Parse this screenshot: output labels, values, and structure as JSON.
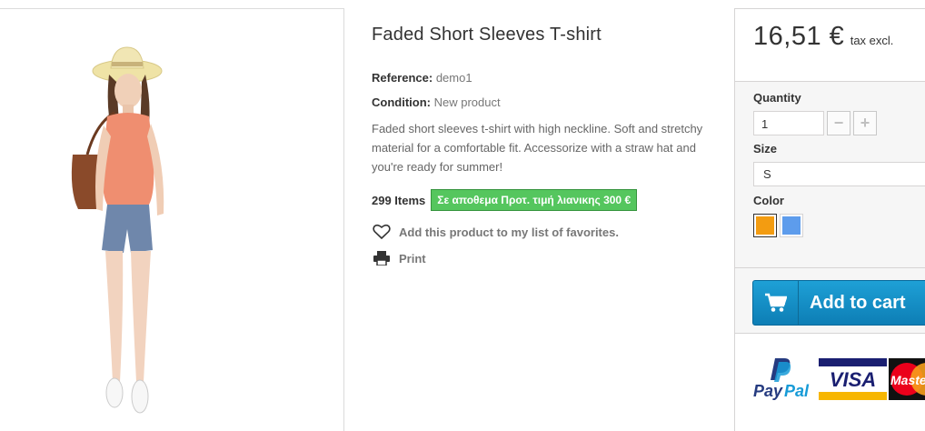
{
  "product": {
    "title": "Faded Short Sleeves T-shirt",
    "reference_label": "Reference:",
    "reference_value": "demo1",
    "condition_label": "Condition:",
    "condition_value": "New product",
    "description": "Faded short sleeves t-shirt with high neckline. Soft and stretchy material for a comfortable fit. Accessorize with a straw hat and you're ready for summer!",
    "stock_count": "299 Items",
    "stock_badge": "Σε αποθεμα Προτ. τιμή λιανικης 300 €",
    "favorites_label": "Add this product to my list of favorites.",
    "print_label": "Print",
    "image_alt": "Faded Short Sleeves T-shirt model photo"
  },
  "buy_box": {
    "price": "16,51 €",
    "tax_label": "tax excl.",
    "quantity_label": "Quantity",
    "quantity_value": "1",
    "minus_label": "−",
    "plus_label": "+",
    "size_label": "Size",
    "size_value": "S",
    "color_label": "Color",
    "colors": [
      "#f39c11",
      "#5d9cec"
    ],
    "add_to_cart_label": "Add to cart"
  },
  "payment": {
    "paypal_1": "Pay",
    "paypal_2": "Pal",
    "visa": "VISA",
    "master": "Maste"
  },
  "icons": {
    "favorite": "heart-icon",
    "print": "printer-icon",
    "cart": "cart-icon"
  }
}
